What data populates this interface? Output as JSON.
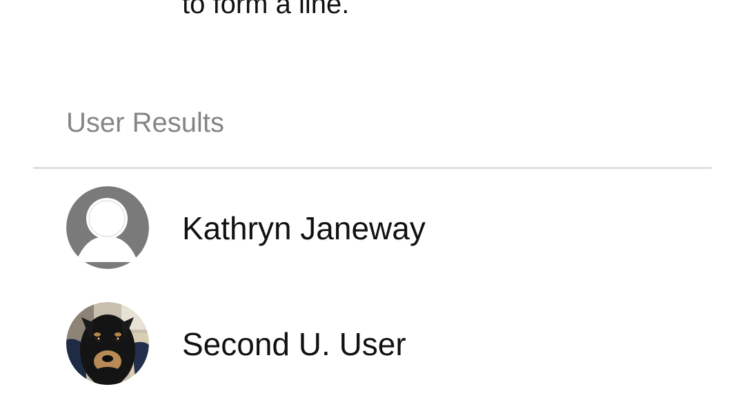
{
  "previous_result": {
    "text": "to form a line."
  },
  "user_results": {
    "header": "User Results",
    "users": [
      {
        "name": "Kathryn Janeway",
        "avatar": "default-person-icon"
      },
      {
        "name": "Second U. User",
        "avatar": "dog-photo"
      }
    ]
  },
  "colors": {
    "header_text": "#858585",
    "primary_text": "#111111",
    "divider": "#e0e0e0",
    "default_avatar": "#7a7a7a"
  }
}
